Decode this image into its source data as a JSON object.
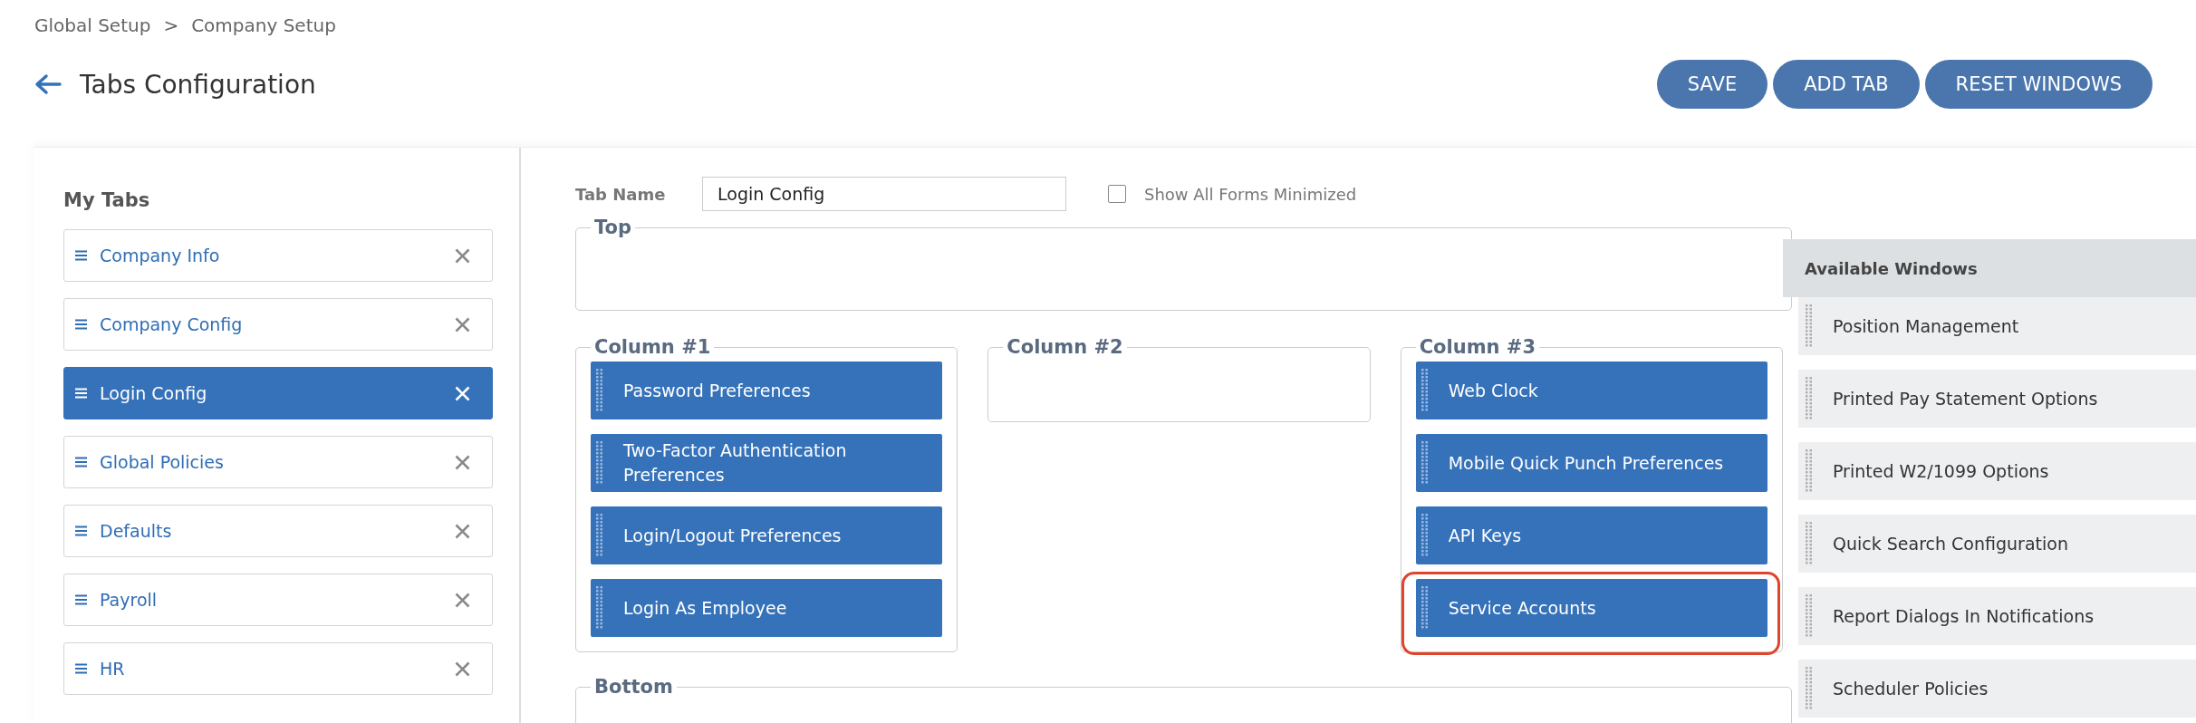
{
  "breadcrumb": [
    "Global Setup",
    "Company Setup"
  ],
  "breadcrumb_separator": ">",
  "page_title": "Tabs Configuration",
  "actions": [
    "SAVE",
    "ADD TAB",
    "RESET WINDOWS"
  ],
  "my_tabs": {
    "title": "My Tabs",
    "items": [
      {
        "label": "Company Info",
        "selected": false
      },
      {
        "label": "Company Config",
        "selected": false
      },
      {
        "label": "Login Config",
        "selected": true
      },
      {
        "label": "Global Policies",
        "selected": false
      },
      {
        "label": "Defaults",
        "selected": false
      },
      {
        "label": "Payroll",
        "selected": false
      },
      {
        "label": "HR",
        "selected": false
      }
    ]
  },
  "editor": {
    "tab_name_label": "Tab Name",
    "tab_name_value": "Login Config",
    "show_minimized": {
      "label": "Show All Forms Minimized",
      "checked": false
    },
    "top": {
      "title": "Top"
    },
    "columns": [
      {
        "title": "Column #1",
        "items": [
          {
            "label": "Password Preferences",
            "highlighted": false
          },
          {
            "label": "Two-Factor Authentication Preferences",
            "highlighted": false
          },
          {
            "label": "Login/Logout Preferences",
            "highlighted": false
          },
          {
            "label": "Login As Employee",
            "highlighted": false
          }
        ]
      },
      {
        "title": "Column #2"
      },
      {
        "title": "Column #3",
        "items": [
          {
            "label": "Web Clock",
            "highlighted": false
          },
          {
            "label": "Mobile Quick Punch Preferences",
            "highlighted": false
          },
          {
            "label": "API Keys",
            "highlighted": false
          },
          {
            "label": "Service Accounts",
            "highlighted": true
          }
        ]
      }
    ],
    "bottom": {
      "title": "Bottom"
    }
  },
  "available_windows": {
    "title": "Available Windows",
    "items": [
      "Position Management",
      "Printed Pay Statement Options",
      "Printed W2/1099 Options",
      "Quick Search Configuration",
      "Report Dialogs In Notifications",
      "Scheduler Policies"
    ]
  }
}
